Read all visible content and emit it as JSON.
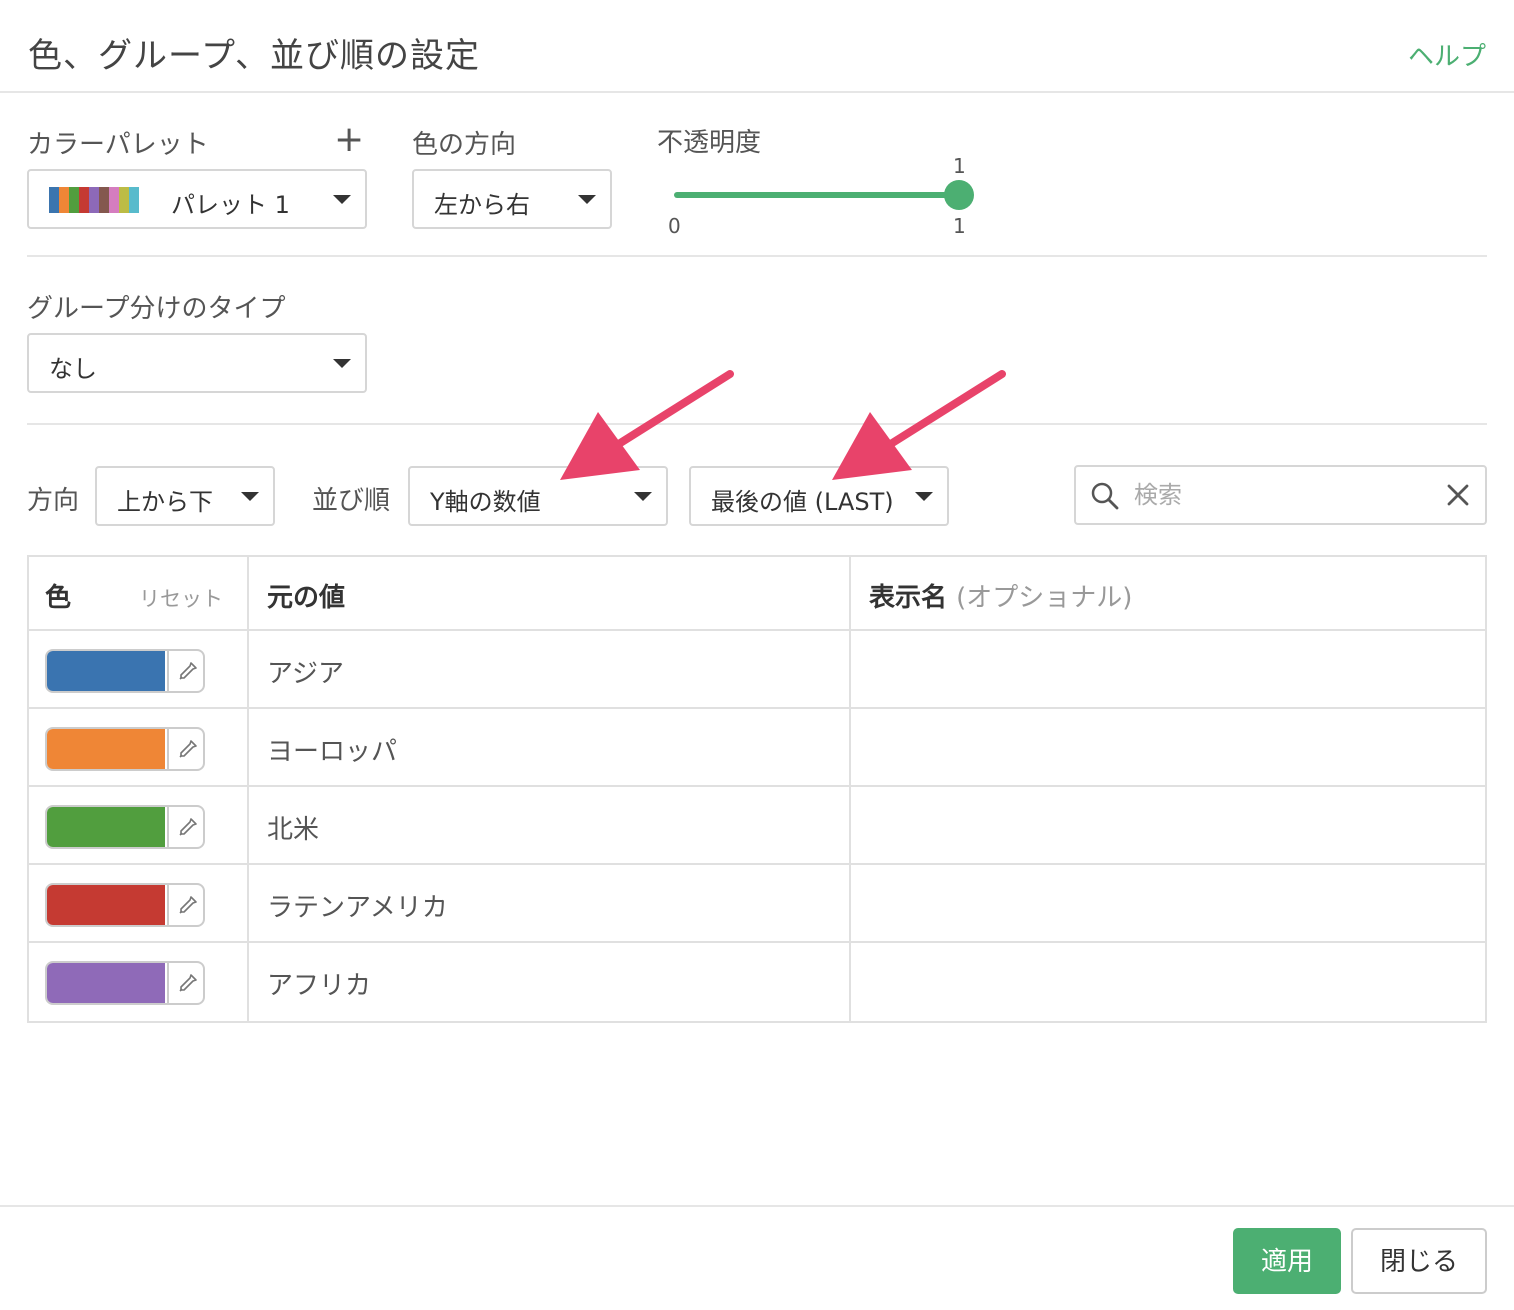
{
  "dialog": {
    "title": "色、グループ、並び順の設定",
    "help_label": "ヘルプ"
  },
  "color_palette": {
    "label": "カラーパレット",
    "add_symbol": "+",
    "selected": "パレット 1",
    "swatch_colors": [
      "#3b75af",
      "#ef8636",
      "#519e3e",
      "#c53a32",
      "#8d69b8",
      "#84584e",
      "#d57dbf",
      "#bcbc45",
      "#58bbcc"
    ]
  },
  "color_direction": {
    "label": "色の方向",
    "selected": "左から右"
  },
  "opacity": {
    "label": "不透明度",
    "value": 1,
    "value_label": "1",
    "min_label": "0",
    "max_label": "1"
  },
  "grouping": {
    "label": "グループ分けのタイプ",
    "selected": "なし"
  },
  "sorting": {
    "direction_label": "方向",
    "direction_selected": "上から下",
    "order_label": "並び順",
    "order_selected": "Y軸の数値",
    "aggregate_selected": "最後の値 (LAST)"
  },
  "search": {
    "placeholder": "検索"
  },
  "table": {
    "header_color": "色",
    "header_reset": "リセット",
    "header_value": "元の値",
    "header_display": "表示名",
    "header_display_hint": "(オプショナル)",
    "rows": [
      {
        "value": "アジア",
        "color": "#3a74b0",
        "display": ""
      },
      {
        "value": "ヨーロッパ",
        "color": "#ef8636",
        "display": ""
      },
      {
        "value": "北米",
        "color": "#519e3e",
        "display": ""
      },
      {
        "value": "ラテンアメリカ",
        "color": "#c53a32",
        "display": ""
      },
      {
        "value": "アフリカ",
        "color": "#8f6ab8",
        "display": ""
      }
    ]
  },
  "footer": {
    "apply_label": "適用",
    "close_label": "閉じる"
  },
  "colors": {
    "accent": "#4caf72",
    "annotation_arrow": "#e8436a"
  }
}
